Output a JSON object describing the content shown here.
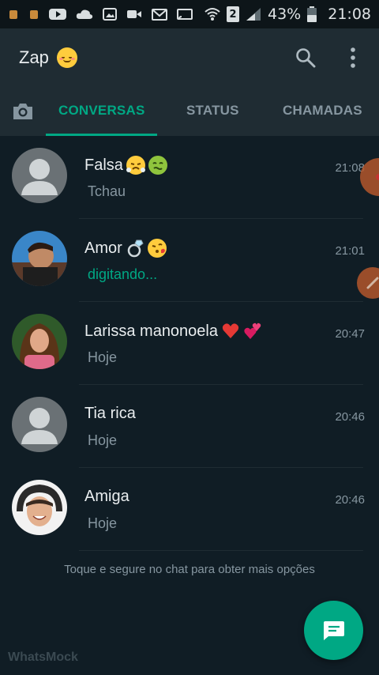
{
  "status_bar": {
    "battery_percent": "43%",
    "time": "21:08",
    "sim_slot": "2"
  },
  "app": {
    "title": "Zap"
  },
  "tabs": [
    {
      "label": "CONVERSAS",
      "active": true
    },
    {
      "label": "STATUS",
      "active": false
    },
    {
      "label": "CHAMADAS",
      "active": false
    }
  ],
  "chats": [
    {
      "name": "Falsa",
      "time": "21:08",
      "preview": "Tchau",
      "typing": false,
      "emojis": [
        "steam-face-emoji",
        "nauseated-face-emoji"
      ]
    },
    {
      "name": "Amor",
      "time": "21:01",
      "preview": "digitando...",
      "typing": true,
      "emojis": [
        "ring-emoji",
        "kiss-face-emoji"
      ]
    },
    {
      "name": "Larissa manonoela",
      "time": "20:47",
      "preview": "Hoje",
      "typing": false,
      "emojis": [
        "red-heart-emoji",
        "two-hearts-emoji"
      ]
    },
    {
      "name": "Tia rica",
      "time": "20:46",
      "preview": "Hoje",
      "typing": false,
      "emojis": []
    },
    {
      "name": "Amiga",
      "time": "20:46",
      "preview": "Hoje",
      "typing": false,
      "emojis": []
    }
  ],
  "hint": "Toque e segure no chat para obter mais opções",
  "watermark": "WhatsMock",
  "colors": {
    "accent": "#00a884",
    "background": "#101d25",
    "header": "#1f2c33"
  }
}
